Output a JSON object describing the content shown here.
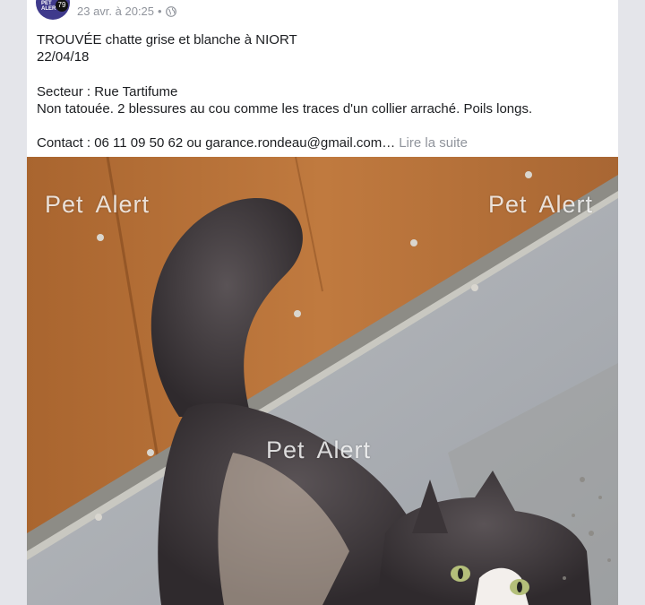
{
  "post": {
    "page_avatar": {
      "label": "PET ALERT",
      "number": "79"
    },
    "timestamp": "23 avr. à 20:25",
    "separator": "•",
    "privacy_icon": "globe-icon",
    "lines": {
      "title": "TROUVÉE chatte grise et blanche à NIORT",
      "date": "22/04/18",
      "sector": "Secteur :  Rue Tartifume",
      "description": "Non tatouée. 2 blessures au cou comme les traces d'un collier arraché. Poils longs.",
      "contact": "Contact : 06 11 09 50 62 ou garance.rondeau@gmail.com…"
    },
    "see_more": "Lire la suite",
    "photo": {
      "watermarks": [
        "Pet  Alert",
        "Pet  Alert",
        "Pet  Alert"
      ]
    }
  },
  "colors": {
    "background": "#e4e5ea",
    "card": "#ffffff",
    "text": "#1c1e21",
    "muted": "#90949c",
    "avatar": "#3f3a8c"
  }
}
